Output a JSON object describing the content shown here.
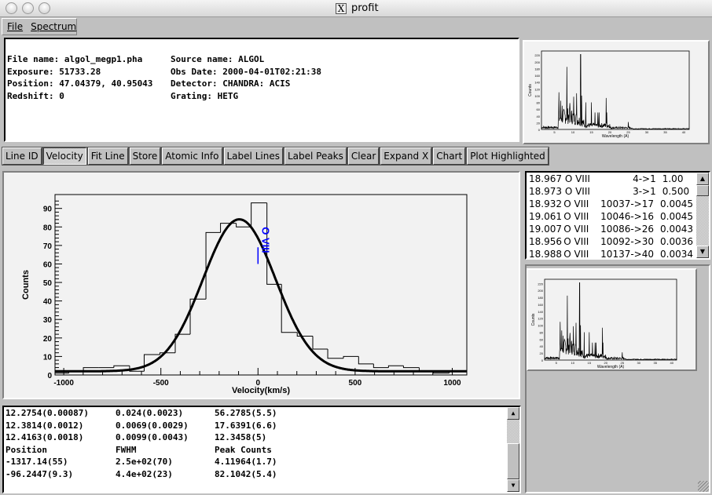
{
  "window": {
    "title": "profit",
    "x_icon": "x11-icon"
  },
  "menu": {
    "file": "File",
    "spectrum": "Spectrum"
  },
  "info": {
    "file_name": "File name: algol_megp1.pha",
    "source_name": "Source name: ALGOL",
    "exposure": "Exposure: 51733.28",
    "obs_date": "Obs Date: 2000-04-01T02:21:38",
    "position": "Position: 47.04379, 40.95043",
    "detector": "Detector: CHANDRA: ACIS",
    "redshift": "Redshift: 0",
    "grating": "Grating: HETG"
  },
  "toolbar": {
    "buttons": [
      "Line ID",
      "Velocity",
      "Fit Line",
      "Store",
      "Atomic Info",
      "Label Lines",
      "Label Peaks",
      "Clear",
      "Expand X",
      "Chart",
      "Plot Highlighted"
    ],
    "active": "Velocity"
  },
  "line_list": [
    [
      "18.967",
      "O VIII",
      "4->1",
      "1.00"
    ],
    [
      "18.973",
      "O VIII",
      "3->1",
      "0.500"
    ],
    [
      "18.932",
      "O VIII",
      "10037->17",
      "0.00456"
    ],
    [
      "19.061",
      "O VIII",
      "10046->16",
      "0.00457"
    ],
    [
      "19.007",
      "O VIII",
      "10086->26",
      "0.00432"
    ],
    [
      "18.956",
      "O VIII",
      "10092->30",
      "0.00360"
    ],
    [
      "18.988",
      "O VIII",
      "10137->40",
      "0.00340"
    ]
  ],
  "output": {
    "rows": [
      [
        "12.2754(0.00087)",
        "0.024(0.0023)",
        "56.2785(5.5)"
      ],
      [
        "12.3814(0.0012)",
        "0.0069(0.0029)",
        "17.6391(6.6)"
      ],
      [
        "12.4163(0.0018)",
        "0.0099(0.0043)",
        "12.3458(5)"
      ],
      [
        "Position",
        "FWHM",
        "Peak Counts"
      ],
      [
        "-1317.14(55)",
        "2.5e+02(70)",
        "4.11964(1.7)"
      ],
      [
        "-96.2447(9.3)",
        "4.4e+02(23)",
        "82.1042(5.4)"
      ]
    ]
  },
  "chart_data": [
    {
      "type": "histogram",
      "xlabel": "Velocity(km/s)",
      "ylabel": "Counts",
      "xlim": [
        -1045,
        1075
      ],
      "ylim": [
        0,
        97.5
      ],
      "xticks": [
        "-1000",
        "-500",
        "0",
        "500",
        "1000"
      ],
      "yticks": [
        "0",
        "10",
        "20",
        "30",
        "40",
        "50",
        "60",
        "70",
        "80",
        "90"
      ],
      "bin_edges": [
        -1045,
        -974,
        -899,
        -820,
        -742,
        -661,
        -586,
        -505,
        -426,
        -349,
        -268,
        -193,
        -112,
        -35,
        46,
        121,
        202,
        282,
        359,
        440,
        518,
        595,
        672,
        749,
        830,
        903,
        984,
        1075
      ],
      "counts": [
        1,
        2,
        4,
        4,
        5,
        2,
        11,
        12,
        22,
        41,
        77,
        82,
        80,
        93,
        49,
        23,
        21,
        14,
        9,
        10,
        6,
        4,
        5,
        4,
        2,
        1,
        2
      ],
      "fit": {
        "center": -96.2447,
        "fwhm": 440,
        "peak": 82.1042,
        "baseline": 2
      },
      "annotation": {
        "label": "O VIII",
        "x": 0,
        "color": "#0000ff"
      }
    },
    {
      "type": "line",
      "xlabel": "Wavelength (A)",
      "ylabel": "Counts",
      "xlim": [
        1.5,
        41.5
      ],
      "ylim": [
        0,
        232
      ],
      "xticks": [
        "5",
        "10",
        "15",
        "20",
        "25",
        "30",
        "35",
        "40"
      ],
      "yticks": [
        "0",
        "20",
        "40",
        "60",
        "80",
        "100",
        "120",
        "140",
        "160",
        "180",
        "200",
        "220"
      ],
      "peaks": [
        [
          6.2,
          110
        ],
        [
          6.7,
          85
        ],
        [
          7.1,
          70
        ],
        [
          8.4,
          185
        ],
        [
          9.2,
          78
        ],
        [
          10.2,
          97
        ],
        [
          11.0,
          107
        ],
        [
          12.1,
          222
        ],
        [
          12.4,
          100
        ],
        [
          13.5,
          80
        ],
        [
          15.0,
          80
        ],
        [
          16.0,
          50
        ],
        [
          16.8,
          50
        ],
        [
          17.1,
          50
        ],
        [
          19.0,
          93
        ],
        [
          19.2,
          50
        ],
        [
          25.0,
          22
        ]
      ]
    }
  ]
}
